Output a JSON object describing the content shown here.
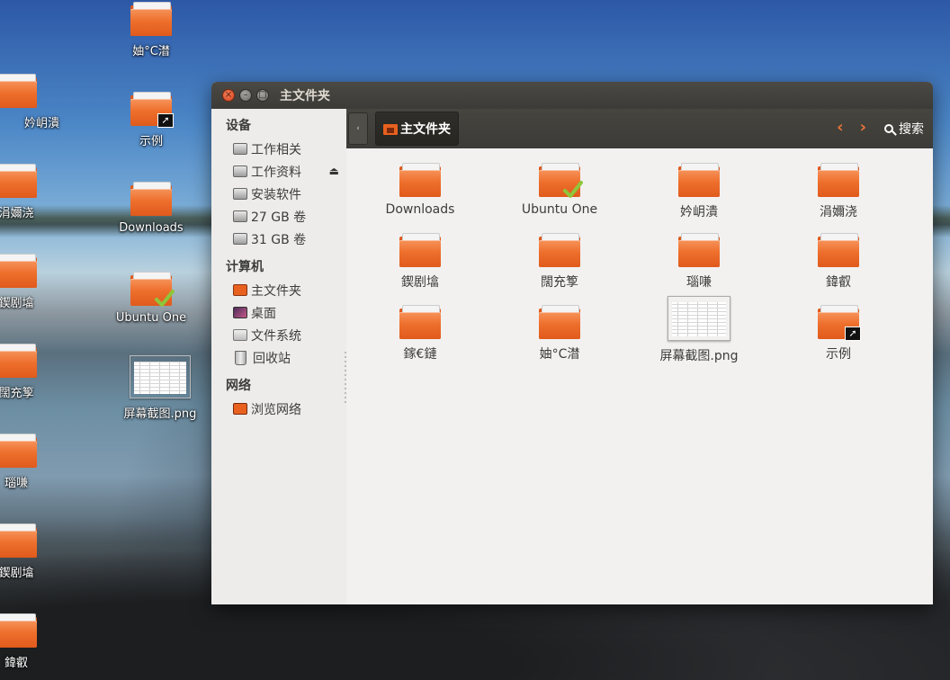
{
  "desktop": {
    "icons": [
      {
        "label": "妯°C澘",
        "kind": "folder"
      },
      {
        "label": "示例",
        "kind": "folder-link"
      },
      {
        "label": "Downloads",
        "kind": "folder"
      },
      {
        "label": "Ubuntu One",
        "kind": "folder-check"
      },
      {
        "label": "屏幕截图.png",
        "kind": "image"
      }
    ],
    "left_partial_labels": [
      "妗岄潰",
      "涓嬭浇",
      "鍥剧墖",
      "闊充箰",
      "瑙嗛",
      "鍥剧墖",
      "鍏叡"
    ]
  },
  "window": {
    "title": "主文件夹",
    "buttons": {
      "close": "×",
      "minimize": "–",
      "maximize": "□"
    }
  },
  "toolbar": {
    "back_toggle": "‹",
    "breadcrumb": "主文件夹",
    "nav_back": "‹",
    "nav_forward": "›",
    "search_label": "搜索"
  },
  "sidebar": {
    "sections": [
      {
        "heading": "设备",
        "items": [
          {
            "label": "工作相关",
            "icon": "drive-icon"
          },
          {
            "label": "工作资料",
            "icon": "drive-icon",
            "eject": "⏏"
          },
          {
            "label": "安装软件",
            "icon": "drive-icon"
          },
          {
            "label": "27 GB 卷",
            "icon": "drive-icon"
          },
          {
            "label": "31 GB 卷",
            "icon": "drive-icon"
          }
        ]
      },
      {
        "heading": "计算机",
        "items": [
          {
            "label": "主文件夹",
            "icon": "home-icon"
          },
          {
            "label": "桌面",
            "icon": "desktop-icon"
          },
          {
            "label": "文件系统",
            "icon": "filesystem-icon"
          },
          {
            "label": "回收站",
            "icon": "trash-icon"
          }
        ]
      },
      {
        "heading": "网络",
        "items": [
          {
            "label": "浏览网络",
            "icon": "network-icon"
          }
        ]
      }
    ]
  },
  "files": [
    {
      "label": "Downloads",
      "kind": "folder"
    },
    {
      "label": "Ubuntu One",
      "kind": "folder-check"
    },
    {
      "label": "妗岄潰",
      "kind": "folder"
    },
    {
      "label": "涓嬭浇",
      "kind": "folder"
    },
    {
      "label": "鍥剧墖",
      "kind": "folder"
    },
    {
      "label": "闊充箰",
      "kind": "folder"
    },
    {
      "label": "瑙嗛",
      "kind": "folder"
    },
    {
      "label": "鍏叡",
      "kind": "folder"
    },
    {
      "label": "鎵€鏈",
      "kind": "folder"
    },
    {
      "label": "妯°C澘",
      "kind": "folder"
    },
    {
      "label": "屏幕截图.png",
      "kind": "image"
    },
    {
      "label": "示例",
      "kind": "folder-link"
    }
  ],
  "colors": {
    "accent": "#e8611f",
    "titlebar": "#3c3b37",
    "nav_arrow": "#e8733a"
  }
}
